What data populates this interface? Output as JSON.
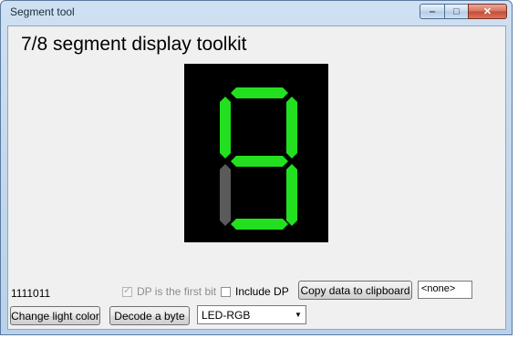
{
  "window": {
    "title": "Segment tool",
    "min_symbol": "‒",
    "max_symbol": "□",
    "close_symbol": "✕"
  },
  "heading": "7/8 segment display toolkit",
  "display": {
    "on_color": "#22e01f",
    "off_color": "#5a5a5a",
    "background": "#000000",
    "segments": {
      "a": true,
      "b": true,
      "c": true,
      "d": true,
      "e": false,
      "f": true,
      "g": true,
      "dp": false
    }
  },
  "bits_text": "1111011",
  "options": {
    "dp_first_bit": {
      "label": "DP is the first bit",
      "checked": true,
      "enabled": false
    },
    "include_dp": {
      "label": "Include DP",
      "checked": false,
      "enabled": true
    }
  },
  "buttons": {
    "copy": "Copy data to clipboard",
    "change_color": "Change light color",
    "decode": "Decode a byte"
  },
  "clipboard_preview": "<none>",
  "led_mode": {
    "selected": "LED-RGB"
  },
  "colors": {
    "accent": "#22e01f",
    "client_bg": "#f0f0f0"
  }
}
